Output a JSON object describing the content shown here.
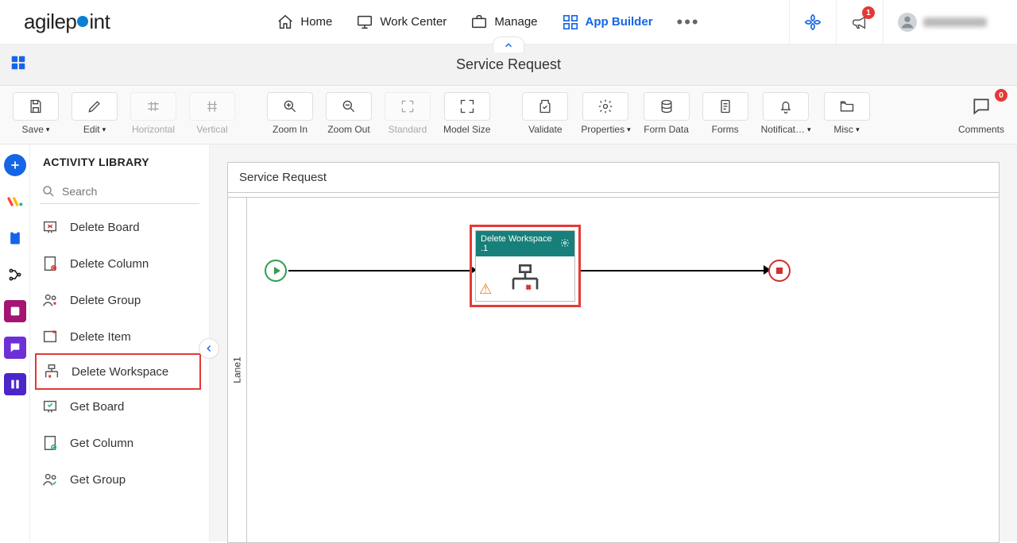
{
  "brand": "agilepoint",
  "header": {
    "nav": {
      "home": "Home",
      "work_center": "Work Center",
      "manage": "Manage",
      "app_builder": "App Builder"
    },
    "notification_count": "1"
  },
  "subheader": {
    "title": "Service Request"
  },
  "toolbar": {
    "save": "Save",
    "edit": "Edit",
    "horizontal": "Horizontal",
    "vertical": "Vertical",
    "zoom_in": "Zoom In",
    "zoom_out": "Zoom Out",
    "standard": "Standard",
    "model_size": "Model Size",
    "validate": "Validate",
    "properties": "Properties",
    "form_data": "Form Data",
    "forms": "Forms",
    "notifications": "Notificat…",
    "misc": "Misc",
    "comments": "Comments",
    "comments_count": "0"
  },
  "library": {
    "title": "ACTIVITY LIBRARY",
    "search_placeholder": "Search",
    "items": [
      "Delete Board",
      "Delete Column",
      "Delete Group",
      "Delete Item",
      "Delete Workspace",
      "Get Board",
      "Get Column",
      "Get Group"
    ]
  },
  "canvas": {
    "process_name": "Service Request",
    "lane_label": "Lane1",
    "activity_title": "Delete Workspace .1"
  }
}
